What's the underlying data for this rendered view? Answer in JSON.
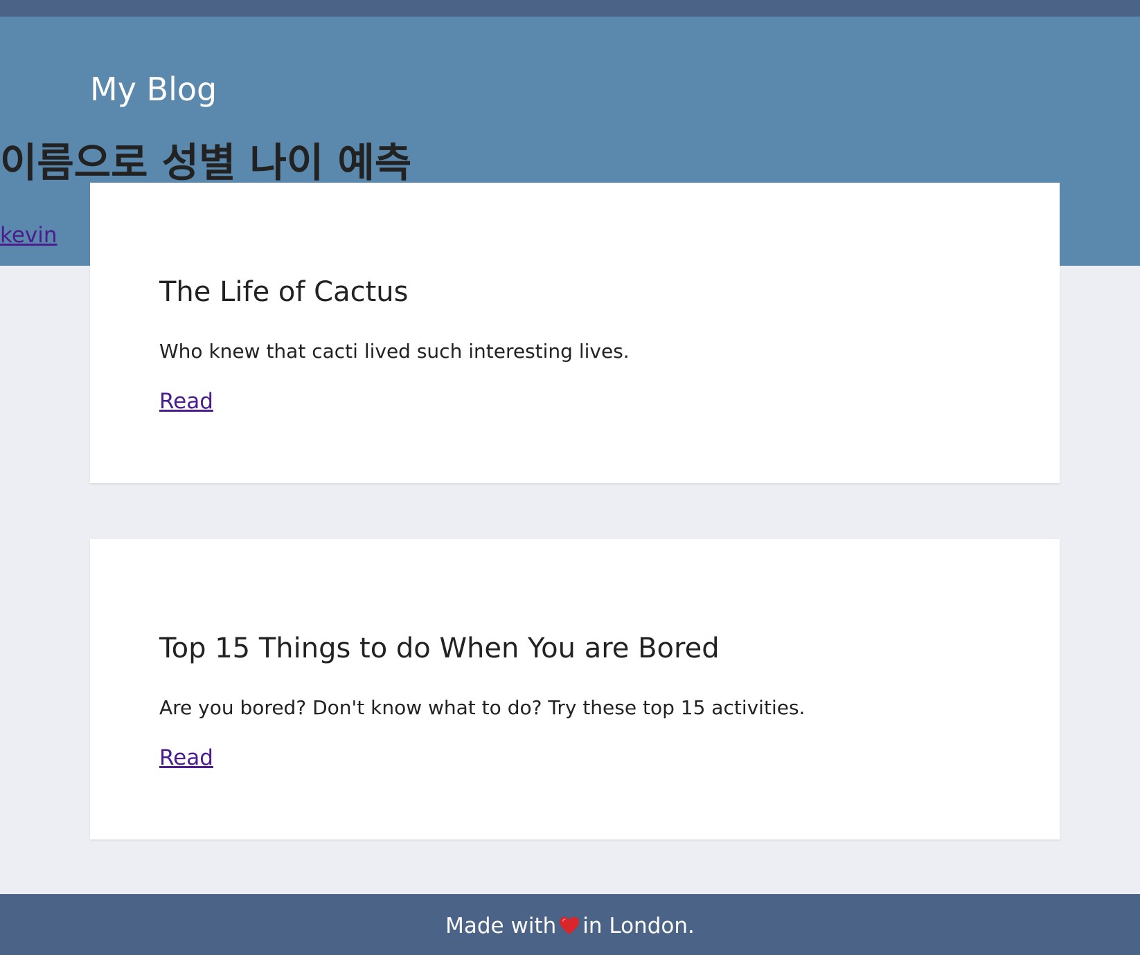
{
  "header": {
    "blog_title": "My Blog",
    "post_heading": "이름으로 성별 나이 예측",
    "author_link": "kevin"
  },
  "posts": [
    {
      "title": "The Life of Cactus",
      "summary": "Who knew that cacti lived such interesting lives.",
      "link_label": "Read"
    },
    {
      "title": "Top 15 Things to do When You are Bored",
      "summary": "Are you bored? Don't know what to do? Try these top 15 activities.",
      "link_label": "Read"
    }
  ],
  "footer": {
    "text_before": "Made with",
    "icon": "heart-icon",
    "text_after": "in London."
  },
  "colors": {
    "header_bg": "#5b89ad",
    "top_bar_bg": "#4a6387",
    "footer_bg": "#4a6387",
    "page_bg": "#edeef3",
    "link": "#4a1c8f",
    "heart": "#d9262b"
  }
}
